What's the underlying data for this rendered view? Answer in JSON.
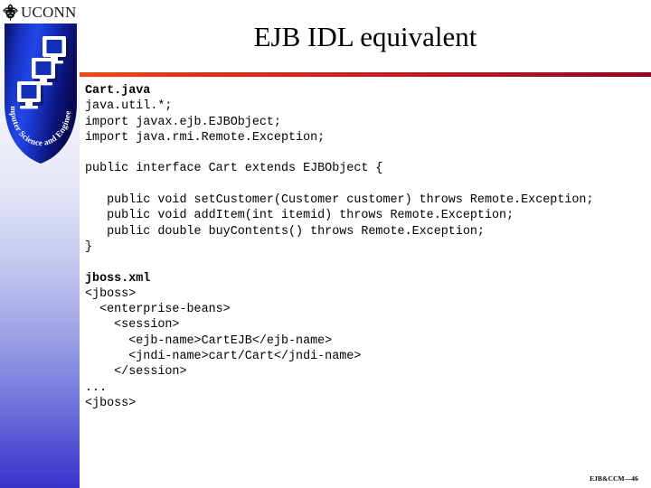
{
  "slide": {
    "title": "EJB IDL equivalent",
    "footer": "EJB&CCM—46"
  },
  "branding": {
    "wordmark": "UCONN",
    "oak_icon": "oak-tree-icon",
    "shield_icon": "cse-shield-icon",
    "shield_motto": "Computer Science and Engineering",
    "shield_color_light": "#1a39d6",
    "shield_color_dark": "#0b0f6b",
    "rule_color_left": "#ef4a17",
    "rule_color_right": "#93001f",
    "sidebar_color_bottom": "#3b34cc"
  },
  "code": {
    "lines": [
      {
        "text": "Cart.java",
        "bold": true
      },
      {
        "text": "java.util.*;",
        "bold": false
      },
      {
        "text": "import javax.ejb.EJBObject;",
        "bold": false
      },
      {
        "text": "import java.rmi.Remote.Exception;",
        "bold": false
      },
      {
        "text": "",
        "bold": false
      },
      {
        "text": "public interface Cart extends EJBObject {",
        "bold": false
      },
      {
        "text": "",
        "bold": false
      },
      {
        "text": "   public void setCustomer(Customer customer) throws Remote.Exception;",
        "bold": false,
        "wrap": true
      },
      {
        "text": "   public void addItem(int itemid) throws Remote.Exception;",
        "bold": false
      },
      {
        "text": "   public double buyContents() throws Remote.Exception;",
        "bold": false
      },
      {
        "text": "}",
        "bold": false
      },
      {
        "text": "",
        "bold": false
      },
      {
        "text": "jboss.xml",
        "bold": true
      },
      {
        "text": "<jboss>",
        "bold": false
      },
      {
        "text": "  <enterprise-beans>",
        "bold": false
      },
      {
        "text": "    <session>",
        "bold": false
      },
      {
        "text": "      <ejb-name>CartEJB</ejb-name>",
        "bold": false
      },
      {
        "text": "      <jndi-name>cart/Cart</jndi-name>",
        "bold": false
      },
      {
        "text": "    </session>",
        "bold": false
      },
      {
        "text": "...",
        "bold": false
      },
      {
        "text": "<jboss>",
        "bold": false
      }
    ]
  }
}
